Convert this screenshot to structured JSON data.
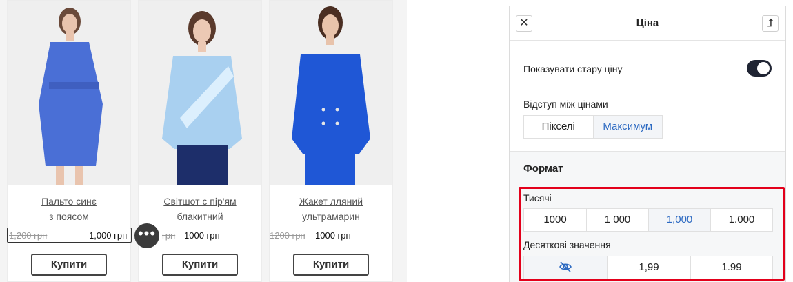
{
  "products": [
    {
      "name_line1": "Пальто синє",
      "name_line2": "з поясом",
      "old_price": "1,200 грн",
      "new_price": "1,000 грн",
      "buy_label": "Купити",
      "garment_color": "#4a6fd6"
    },
    {
      "name_line1": "Світшот с пір'ям",
      "name_line2": "блакитний",
      "old_price": "грн",
      "new_price": "1000 грн",
      "buy_label": "Купити",
      "garment_color": "#a9d0f0"
    },
    {
      "name_line1": "Жакет лляний",
      "name_line2": "ультрамарин",
      "old_price": "1200 грн",
      "new_price": "1000 грн",
      "buy_label": "Купити",
      "garment_color": "#1f57d6"
    }
  ],
  "more_button": {
    "icon": "more-horizontal-icon",
    "glyph": "•••"
  },
  "panel": {
    "title": "Ціна",
    "close_icon": "close-icon",
    "close_glyph": "✕",
    "pin_icon": "arrow-up-icon",
    "pin_glyph": "⮥",
    "show_old_price_label": "Показувати стару ціну",
    "show_old_price_on": true,
    "gap_label": "Відступ між цінами",
    "gap_options": [
      "Пікселі",
      "Максимум"
    ],
    "gap_selected": "Максимум",
    "format_title": "Формат",
    "thousands_label": "Тисячі",
    "thousands_options": [
      "1000",
      "1 000",
      "1,000",
      "1.000"
    ],
    "thousands_selected": "1,000",
    "decimals_label": "Десяткові значення",
    "decimals_options": [
      "hidden",
      "1,99",
      "1.99"
    ],
    "decimals_hidden_icon": "eye-off-icon",
    "decimals_selected": "hidden"
  },
  "colors": {
    "accent_blue": "#2d6ac2",
    "toggle_dark": "#1f2433",
    "highlight_red": "#e3001b"
  }
}
